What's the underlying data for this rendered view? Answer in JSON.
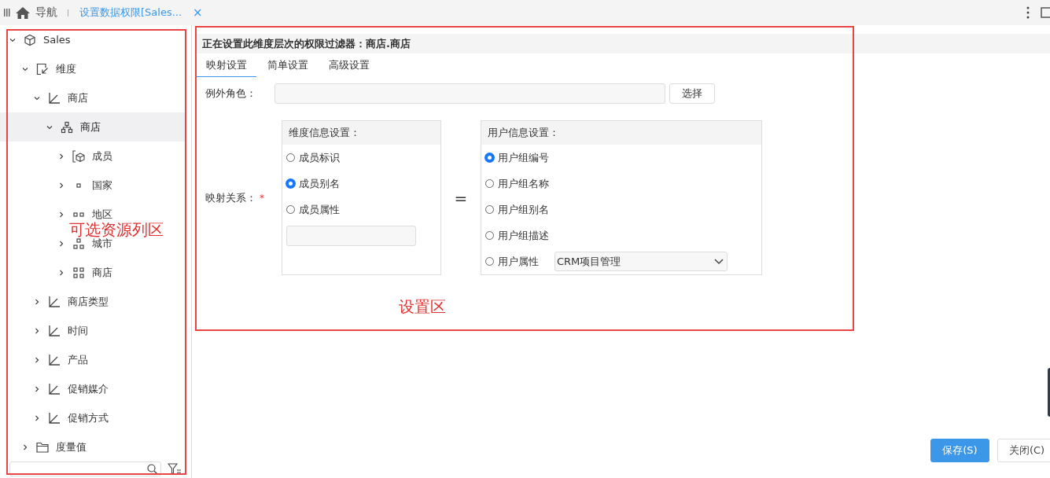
{
  "topbar": {
    "nav_label": "导航",
    "tab": {
      "title": "设置数据权限[Sales...",
      "close": "×",
      "selected": true
    }
  },
  "tree": [
    {
      "label": "Sales",
      "kind": "cube",
      "expanded": true,
      "selected": false,
      "children": [
        {
          "label": "维度",
          "kind": "dimension",
          "expanded": true,
          "selected": false,
          "children": [
            {
              "label": "商店",
              "kind": "axis",
              "expanded": true,
              "selected": false,
              "children": [
                {
                  "label": "商店",
                  "kind": "hierarchy",
                  "expanded": true,
                  "selected": true,
                  "children": [
                    {
                      "label": "成员",
                      "kind": "member",
                      "expanded": false,
                      "selected": false
                    },
                    {
                      "label": "国家",
                      "kind": "level1",
                      "expanded": false,
                      "selected": false
                    },
                    {
                      "label": "地区",
                      "kind": "level2",
                      "expanded": false,
                      "selected": false
                    },
                    {
                      "label": "城市",
                      "kind": "level3",
                      "expanded": false,
                      "selected": false
                    },
                    {
                      "label": "商店",
                      "kind": "level4",
                      "expanded": false,
                      "selected": false
                    }
                  ]
                }
              ]
            },
            {
              "label": "商店类型",
              "kind": "axis",
              "expanded": false,
              "selected": false
            },
            {
              "label": "时间",
              "kind": "axis",
              "expanded": false,
              "selected": false
            },
            {
              "label": "产品",
              "kind": "axis",
              "expanded": false,
              "selected": false
            },
            {
              "label": "促销媒介",
              "kind": "axis",
              "expanded": false,
              "selected": false
            },
            {
              "label": "促销方式",
              "kind": "axis",
              "expanded": false,
              "selected": false
            }
          ]
        },
        {
          "label": "度量值",
          "kind": "folder",
          "expanded": false,
          "selected": false
        }
      ]
    }
  ],
  "settings": {
    "heading": "正在设置此维度层次的权限过滤器：商店.商店",
    "tabs": [
      {
        "label": "映射设置",
        "selected": true
      },
      {
        "label": "简单设置",
        "selected": false
      },
      {
        "label": "高级设置",
        "selected": false
      }
    ],
    "exception_role": {
      "label": "例外角色：",
      "button": "选择"
    },
    "mapping": {
      "label": "映射关系：",
      "required_mark": "*",
      "dimension_panel": {
        "title": "维度信息设置：",
        "options": [
          {
            "label": "成员标识",
            "selected": false
          },
          {
            "label": "成员别名",
            "selected": true
          },
          {
            "label": "成员属性",
            "selected": false
          }
        ]
      },
      "equals": "=",
      "user_panel": {
        "title": "用户信息设置：",
        "options": [
          {
            "label": "用户组编号",
            "selected": true,
            "kind": "plain"
          },
          {
            "label": "用户组名称",
            "selected": false,
            "kind": "plain"
          },
          {
            "label": "用户组别名",
            "selected": false,
            "kind": "plain"
          },
          {
            "label": "用户组描述",
            "selected": false,
            "kind": "plain"
          },
          {
            "label": "用户属性",
            "selected": false,
            "kind": "dropdown",
            "value": "CRM项目管理"
          }
        ]
      }
    }
  },
  "buttons": [
    {
      "label": "保存(S)",
      "kind": "primary"
    },
    {
      "label": "关闭(C)",
      "kind": "secondary"
    }
  ],
  "annotations": [
    {
      "text": "可选资源列区"
    },
    {
      "text": "设置区"
    }
  ]
}
